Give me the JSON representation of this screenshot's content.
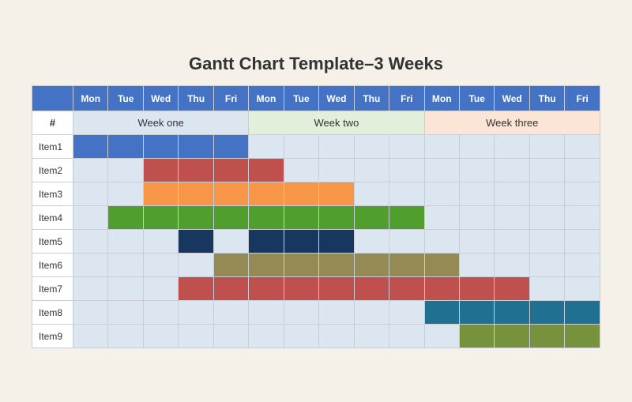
{
  "title": "Gantt Chart Template–3 Weeks",
  "weeks": [
    {
      "label": "Week one",
      "class": "week-one"
    },
    {
      "label": "Week two",
      "class": "week-two"
    },
    {
      "label": "Week three",
      "class": "week-three"
    }
  ],
  "days": [
    "Mon",
    "Tue",
    "Wed",
    "Thu",
    "Fri",
    "Mon",
    "Tue",
    "Wed",
    "Thu",
    "Fri",
    "Mon",
    "Tue",
    "Wed",
    "Thu",
    "Fri"
  ],
  "hash": "#",
  "rows": [
    {
      "label": "Item1",
      "cells": [
        "blue",
        "blue",
        "blue",
        "blue",
        "blue",
        "empty",
        "empty",
        "empty",
        "empty",
        "empty",
        "empty",
        "empty",
        "empty",
        "empty",
        "empty"
      ]
    },
    {
      "label": "Item2",
      "cells": [
        "empty",
        "empty",
        "red",
        "red",
        "red",
        "red",
        "empty",
        "empty",
        "empty",
        "empty",
        "empty",
        "empty",
        "empty",
        "empty",
        "empty"
      ]
    },
    {
      "label": "Item3",
      "cells": [
        "empty",
        "empty",
        "orange",
        "orange",
        "orange",
        "orange",
        "orange",
        "orange",
        "empty",
        "empty",
        "empty",
        "empty",
        "empty",
        "empty",
        "empty"
      ]
    },
    {
      "label": "Item4",
      "cells": [
        "empty",
        "green",
        "green",
        "green",
        "green",
        "green",
        "green",
        "green",
        "green",
        "green",
        "empty",
        "empty",
        "empty",
        "empty",
        "empty"
      ]
    },
    {
      "label": "Item5",
      "cells": [
        "empty",
        "empty",
        "empty",
        "dark-blue",
        "empty",
        "dark-blue",
        "dark-blue",
        "dark-blue",
        "empty",
        "empty",
        "empty",
        "empty",
        "empty",
        "empty",
        "empty"
      ]
    },
    {
      "label": "Item6",
      "cells": [
        "empty",
        "empty",
        "empty",
        "empty",
        "olive",
        "olive",
        "olive",
        "olive",
        "olive",
        "olive",
        "olive",
        "empty",
        "empty",
        "empty",
        "empty"
      ]
    },
    {
      "label": "Item7",
      "cells": [
        "empty",
        "empty",
        "empty",
        "red",
        "red",
        "red",
        "red",
        "red",
        "red",
        "red",
        "red",
        "red",
        "red",
        "empty",
        "empty"
      ]
    },
    {
      "label": "Item8",
      "cells": [
        "empty",
        "empty",
        "empty",
        "empty",
        "empty",
        "empty",
        "empty",
        "empty",
        "empty",
        "empty",
        "teal",
        "teal",
        "teal",
        "teal",
        "teal"
      ]
    },
    {
      "label": "Item9",
      "cells": [
        "empty",
        "empty",
        "empty",
        "empty",
        "empty",
        "empty",
        "empty",
        "empty",
        "empty",
        "empty",
        "empty",
        "light-green",
        "light-green",
        "light-green",
        "light-green"
      ]
    }
  ]
}
